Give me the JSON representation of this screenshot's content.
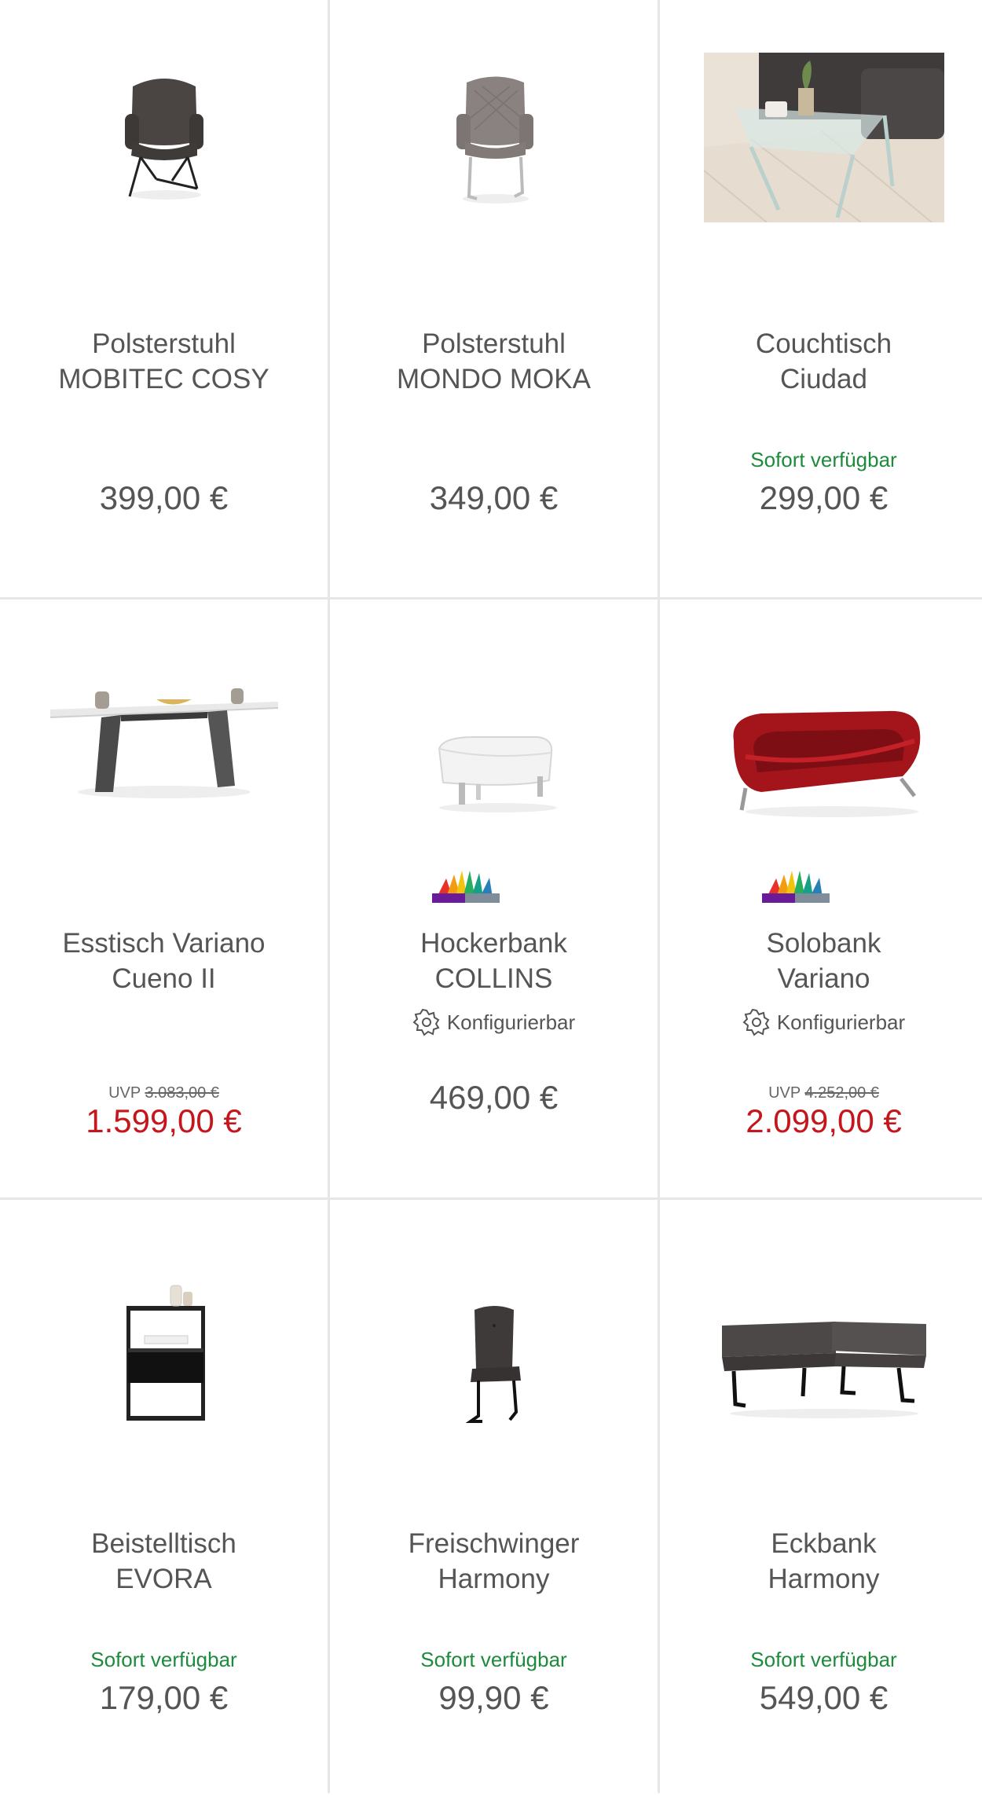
{
  "products": [
    {
      "name_line1": "Polsterstuhl",
      "name_line2": "MOBITEC COSY",
      "availability": "",
      "uvp_label": "",
      "uvp_price": "",
      "price": "399,00 €",
      "configurable": "",
      "image_icon": "armchair-dark-icon"
    },
    {
      "name_line1": "Polsterstuhl",
      "name_line2": "MONDO MOKA",
      "availability": "",
      "uvp_label": "",
      "uvp_price": "",
      "price": "349,00 €",
      "configurable": "",
      "image_icon": "armchair-grey-icon"
    },
    {
      "name_line1": "Couchtisch",
      "name_line2": "Ciudad",
      "availability": "Sofort verfügbar",
      "uvp_label": "",
      "uvp_price": "",
      "price": "299,00 €",
      "configurable": "",
      "image_icon": "glass-table-photo-icon"
    },
    {
      "name_line1": "Esstisch Variano",
      "name_line2": "Cueno II",
      "availability": "",
      "uvp_label": "UVP",
      "uvp_price": "3.083,00 €",
      "price": "1.599,00 €",
      "configurable": "",
      "image_icon": "dining-table-icon"
    },
    {
      "name_line1": "Hockerbank",
      "name_line2": "COLLINS",
      "availability": "",
      "uvp_label": "",
      "uvp_price": "",
      "price": "469,00 €",
      "configurable": "Konfigurierbar",
      "image_icon": "ottoman-icon"
    },
    {
      "name_line1": "Solobank",
      "name_line2": "Variano",
      "availability": "",
      "uvp_label": "UVP",
      "uvp_price": "4.252,00 €",
      "price": "2.099,00 €",
      "configurable": "Konfigurierbar",
      "image_icon": "red-bench-icon"
    },
    {
      "name_line1": "Beistelltisch",
      "name_line2": "EVORA",
      "availability": "Sofort verfügbar",
      "uvp_label": "",
      "uvp_price": "",
      "price": "179,00 €",
      "configurable": "",
      "image_icon": "side-table-icon"
    },
    {
      "name_line1": "Freischwinger",
      "name_line2": "Harmony",
      "availability": "Sofort verfügbar",
      "uvp_label": "",
      "uvp_price": "",
      "price": "99,90 €",
      "configurable": "",
      "image_icon": "cantilever-chair-icon"
    },
    {
      "name_line1": "Eckbank",
      "name_line2": "Harmony",
      "availability": "Sofort verfügbar",
      "uvp_label": "",
      "uvp_price": "",
      "price": "549,00 €",
      "configurable": "",
      "image_icon": "corner-bench-icon"
    }
  ],
  "colors": {
    "availability": "#1d8a3c",
    "sale_price": "#c4161c",
    "text": "#555555",
    "divider": "#e6e6e6"
  }
}
